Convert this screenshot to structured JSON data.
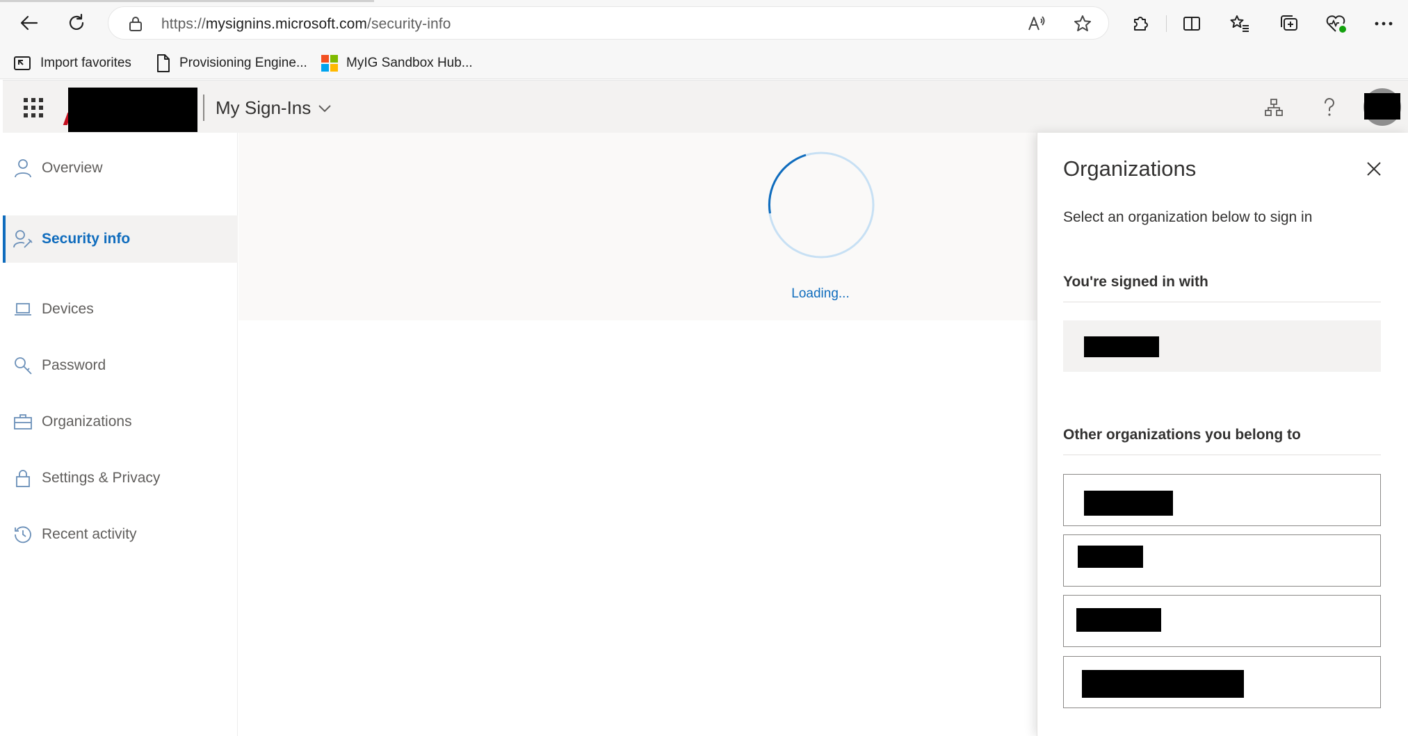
{
  "browser": {
    "url_prefix": "https://",
    "url_host": "mysignins.microsoft.com",
    "url_path": "/security-info",
    "bookmarks": [
      {
        "label": "Import favorites",
        "icon": "import-icon"
      },
      {
        "label": "Provisioning Engine...",
        "icon": "page-icon"
      },
      {
        "label": "MyIG Sandbox Hub...",
        "icon": "microsoft-logo-icon"
      }
    ]
  },
  "header": {
    "app_title": "My Sign-Ins"
  },
  "sidebar": {
    "items": [
      {
        "label": "Overview",
        "icon": "person-icon",
        "active": false
      },
      {
        "label": "Security info",
        "icon": "person-key-icon",
        "active": true
      },
      {
        "label": "Devices",
        "icon": "laptop-icon",
        "active": false
      },
      {
        "label": "Password",
        "icon": "key-icon",
        "active": false
      },
      {
        "label": "Organizations",
        "icon": "briefcase-icon",
        "active": false
      },
      {
        "label": "Settings & Privacy",
        "icon": "lock-icon",
        "active": false
      },
      {
        "label": "Recent activity",
        "icon": "history-icon",
        "active": false
      }
    ]
  },
  "main": {
    "loading_text": "Loading..."
  },
  "panel": {
    "title": "Organizations",
    "subtitle": "Select an organization below to sign in",
    "signed_in_heading": "You're signed in with",
    "other_heading": "Other organizations you belong to"
  },
  "colors": {
    "accent": "#0f6cbd",
    "header_bg": "#f3f2f1"
  }
}
